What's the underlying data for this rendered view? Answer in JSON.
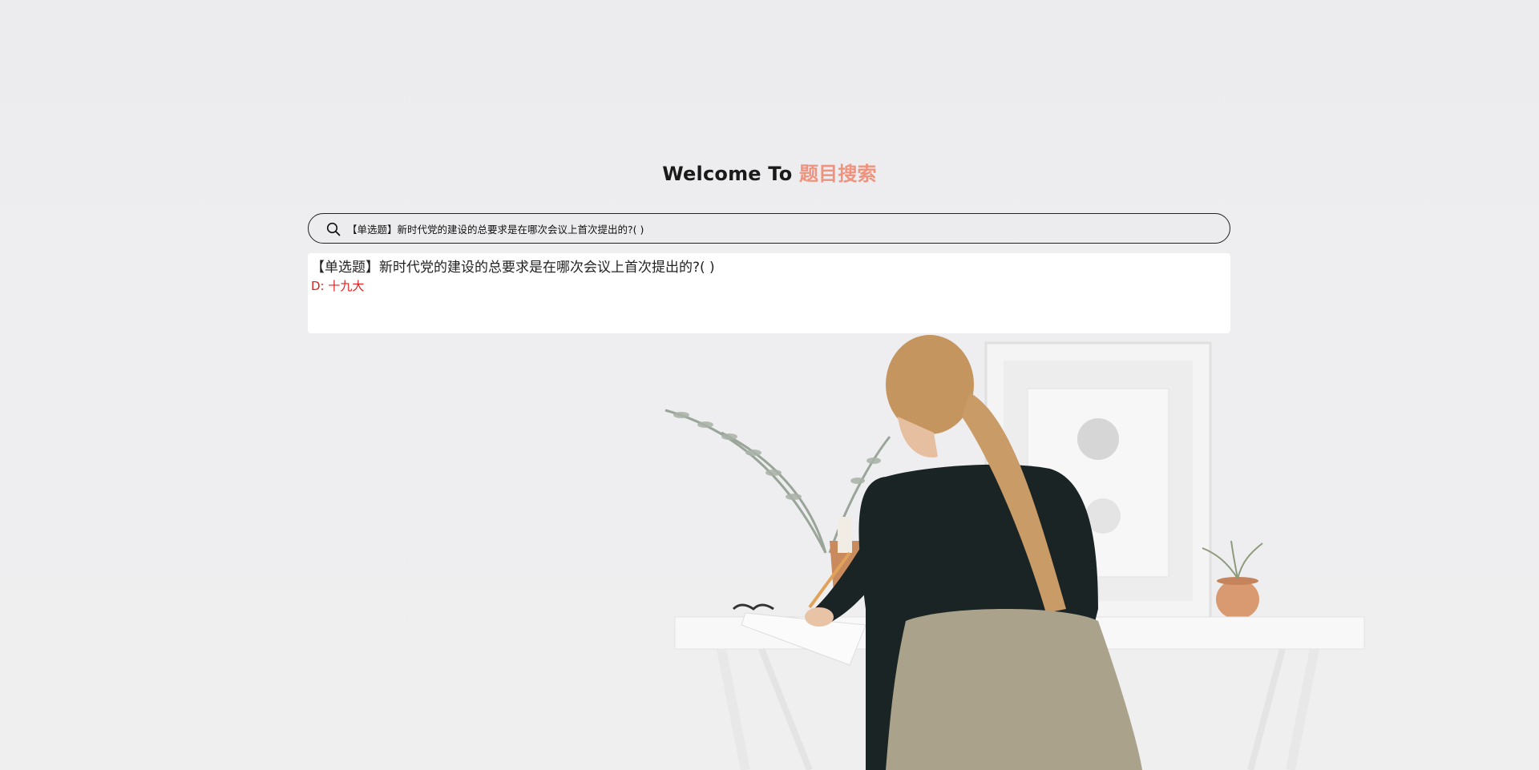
{
  "header": {
    "welcome_text": "Welcome To ",
    "brand_text": "题目搜索"
  },
  "search": {
    "value": "【单选题】新时代党的建设的总要求是在哪次会议上首次提出的?( )",
    "icon": "search-icon"
  },
  "result": {
    "question": "【单选题】新时代党的建设的总要求是在哪次会议上首次提出的?( )",
    "answer": "D: 十九大"
  },
  "colors": {
    "brand_accent": "#f0937e",
    "answer_red": "#e02020",
    "background": "#ececee"
  }
}
